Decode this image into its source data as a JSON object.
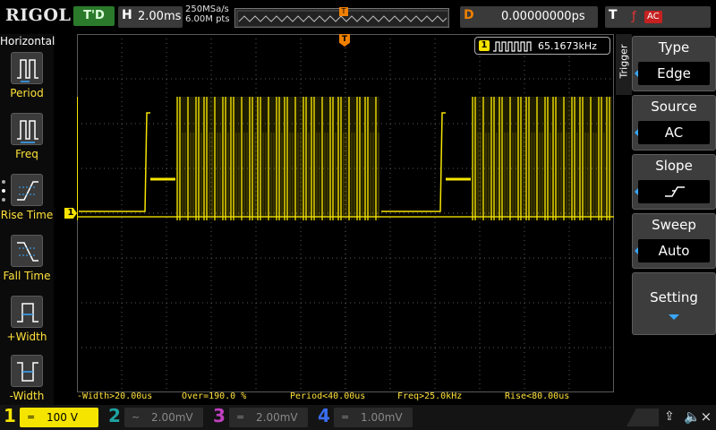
{
  "brand": "RIGOL",
  "run_status": "T'D",
  "timebase": {
    "letter": "H",
    "value": "2.00ms"
  },
  "sample": {
    "rate": "250MSa/s",
    "points": "6.00M pts"
  },
  "trigger_marker": "T",
  "delay": {
    "letter": "D",
    "value": "0.00000000ps"
  },
  "trigger_status": {
    "letter": "T",
    "source": "AC"
  },
  "left_panel": {
    "title": "Horizontal",
    "buttons": [
      {
        "label": "Period",
        "icon": "period-icon"
      },
      {
        "label": "Freq",
        "icon": "freq-icon"
      },
      {
        "label": "Rise Time",
        "icon": "rise-time-icon"
      },
      {
        "label": "Fall Time",
        "icon": "fall-time-icon"
      },
      {
        "label": "+Width",
        "icon": "positive-width-icon"
      },
      {
        "label": "-Width",
        "icon": "negative-width-icon"
      }
    ]
  },
  "frequency_counter": {
    "channel": "1",
    "value": "65.1673kHz"
  },
  "channel_marker": "1",
  "right_menu": {
    "tab": "Trigger",
    "items": [
      {
        "title": "Type",
        "value": "Edge"
      },
      {
        "title": "Source",
        "value": "AC"
      },
      {
        "title": "Slope",
        "value": ""
      },
      {
        "title": "Sweep",
        "value": "Auto"
      }
    ],
    "setting": "Setting"
  },
  "measurements": [
    "-Width>20.00us",
    "Over=190.0 %",
    "Period<40.00us",
    "Freq>25.0kHz",
    "Rise<80.00us"
  ],
  "channels": [
    {
      "num": "1",
      "coupling": "=",
      "scale": "100 V",
      "color": "#f5e400"
    },
    {
      "num": "2",
      "coupling": "~",
      "scale": "2.00mV",
      "color": "#1fa2a2"
    },
    {
      "num": "3",
      "coupling": "=",
      "scale": "2.00mV",
      "color": "#c040c0"
    },
    {
      "num": "4",
      "coupling": "=",
      "scale": "1.00mV",
      "color": "#3a6df0"
    }
  ],
  "colors": {
    "ch1": "#f5e400",
    "grid": "#5a5a5a",
    "accent": "#f08000"
  }
}
